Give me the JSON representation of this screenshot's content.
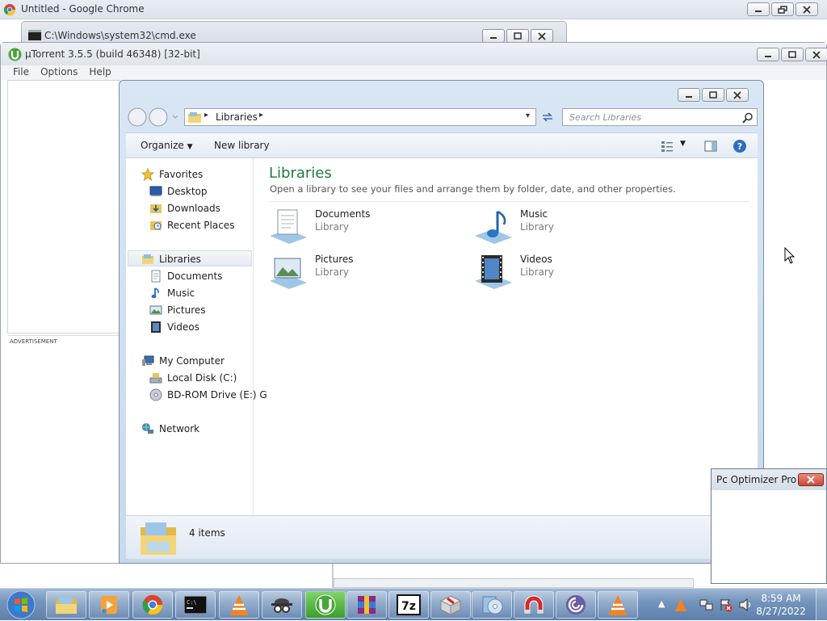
{
  "chrome": {
    "title": "Untitled - Google Chrome"
  },
  "cmd": {
    "title": "C:\\Windows\\system32\\cmd.exe"
  },
  "utorrent": {
    "title": "µTorrent 3.5.5  (build 46348) [32-bit]",
    "menu": [
      "File",
      "Options",
      "Help"
    ],
    "ad_label": "ADVERTISEMENT"
  },
  "explorer": {
    "breadcrumb": "Libraries",
    "search_placeholder": "Search Libraries",
    "toolbar": {
      "organize": "Organize",
      "new_library": "New library"
    },
    "nav": {
      "favorites": "Favorites",
      "desktop": "Desktop",
      "downloads": "Downloads",
      "recent": "Recent Places",
      "libraries": "Libraries",
      "documents": "Documents",
      "music": "Music",
      "pictures": "Pictures",
      "videos": "Videos",
      "computer": "My Computer",
      "local_disk": "Local Disk (C:)",
      "bdrom": "BD-ROM Drive (E:) G",
      "network": "Network"
    },
    "content": {
      "heading": "Libraries",
      "description": "Open a library to see your files and arrange them by folder, date, and other properties.",
      "tiles": [
        {
          "name": "Documents",
          "type": "Library"
        },
        {
          "name": "Music",
          "type": "Library"
        },
        {
          "name": "Pictures",
          "type": "Library"
        },
        {
          "name": "Videos",
          "type": "Library"
        }
      ]
    },
    "status": "4 items"
  },
  "popup": {
    "title": "Pc Optimizer Pro"
  },
  "taskbar": {
    "time": "8:59 AM",
    "date": "8/27/2022",
    "apps": [
      "explorer-icon",
      "media-player-icon",
      "chrome-icon",
      "cmd-icon",
      "vlc-icon",
      "spy-icon",
      "utorrent-icon",
      "winrar-icon",
      "7zip-icon",
      "package-icon",
      "disc-tool-icon",
      "magnet-icon",
      "bittorrent-icon",
      "vlc-icon"
    ]
  },
  "colors": {
    "accent": "#1e7c3c",
    "taskbar": "#6f8fb8",
    "close": "#c94b3c"
  }
}
